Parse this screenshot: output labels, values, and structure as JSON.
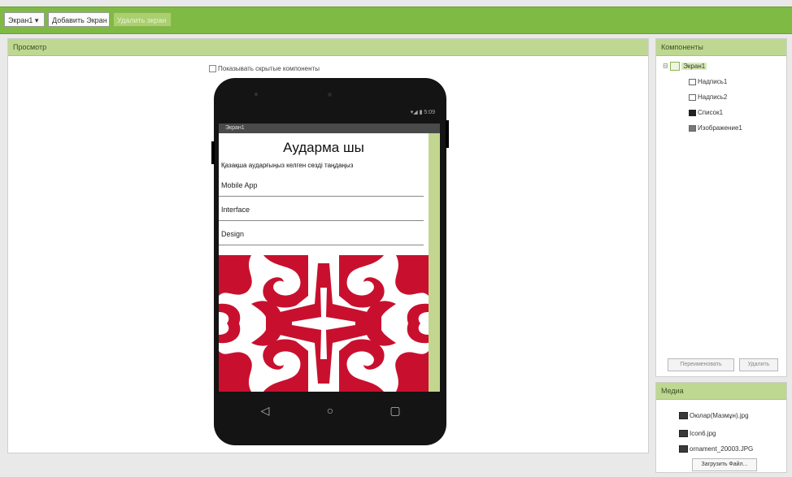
{
  "toolbar": {
    "screen_select": "Экран1 ▾",
    "add_screen": "Добавить Экран",
    "remove_screen": "Удалить экран"
  },
  "viewer": {
    "title": "Просмотр",
    "show_hidden_label": "Показывать скрытые компоненты"
  },
  "phone": {
    "screen_title": "Экран1",
    "status_text": "5:09",
    "app_title": "Аударма шы",
    "app_label": "Қазақша аударғыңыз келген сөзді таңдаңыз",
    "list_items": [
      "Mobile App",
      "Interface",
      "Design"
    ],
    "ornament_color": "#c8102e",
    "scrollbar_color": "#c3d68f"
  },
  "components": {
    "title": "Компоненты",
    "tree": {
      "root": "Экран1",
      "children": [
        "Надпись1",
        "Надпись2",
        "Список1",
        "Изображение1"
      ]
    },
    "rename_button": "Переименовать",
    "delete_button": "Удалить"
  },
  "media": {
    "title": "Медиа",
    "files": [
      "Оюлар(Мазмұн).jpg",
      "Icon6.jpg",
      "ornament_20003.JPG"
    ],
    "upload_button": "Загрузить Файл..."
  },
  "colors": {
    "accent": "#7fba44",
    "header": "#bed891"
  }
}
